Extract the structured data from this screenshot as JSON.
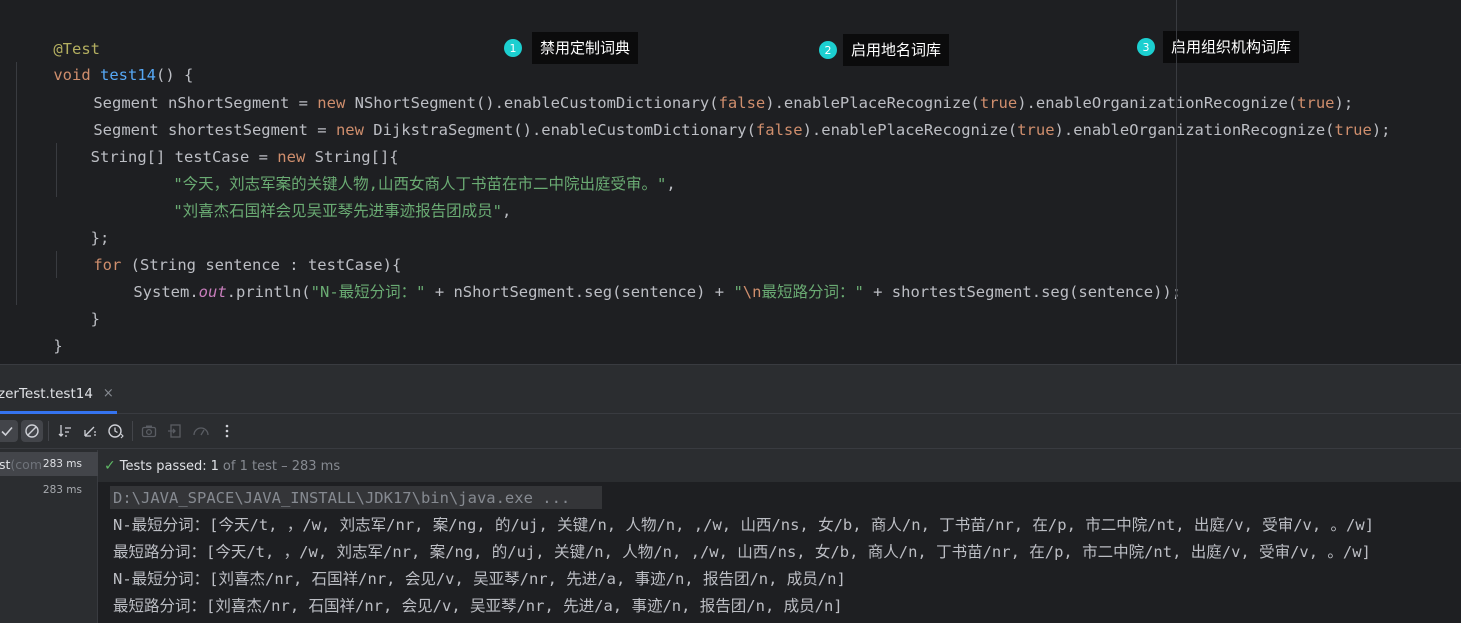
{
  "editor": {
    "annotation": "@Test",
    "method_sig": {
      "void": "void",
      "name": "test14",
      "rest": "() {"
    },
    "line3": {
      "indent": "    ",
      "type": "Segment",
      "var": " nShortSegment = ",
      "new": "new",
      "cls": " NShortSegment().enableCustomDictionary(",
      "b1": "false",
      "m2": ").enablePlaceRecognize(",
      "b2": "true",
      "m3": ").enableOrganizationRecognize(",
      "b3": "true",
      "end": ");"
    },
    "line4": {
      "indent": "    ",
      "type": "Segment",
      "var": " shortestSegment = ",
      "new": "new",
      "cls": " DijkstraSegment().enableCustomDictionary(",
      "b1": "false",
      "m2": ").enablePlaceRecognize(",
      "b2": "true",
      "m3": ").enableOrganizationRecognize(",
      "b3": "true",
      "end": ");"
    },
    "line5": {
      "pre": "    String[] testCase = ",
      "new": "new",
      "post": " String[]{"
    },
    "line6": {
      "str": "\"今天，刘志军案的关键人物,山西女商人丁书苗在市二中院出庭受审。\"",
      "end": ","
    },
    "line7": {
      "str": "\"刘喜杰石国祥会见吴亚琴先进事迹报告团成员\"",
      "end": ","
    },
    "line8": "    };",
    "line9": {
      "for": "for",
      "rest": " (String sentence : testCase){"
    },
    "line10": {
      "pre": "System.",
      "out": "out",
      "mid": ".println(",
      "s1": "\"N-最短分词：\"",
      "plus1": " + nShortSegment.seg(sentence) + ",
      "s2a": "\"",
      "esc": "\\n",
      "s2b": "最短路分词：\"",
      "plus2": " + shortestSegment.seg(sentence));"
    },
    "line11": "    }",
    "line12": "}"
  },
  "callouts": [
    {
      "num": "1",
      "label": "禁用定制词典"
    },
    {
      "num": "2",
      "label": "启用地名词库"
    },
    {
      "num": "3",
      "label": "启用组织机构词库"
    }
  ],
  "run_panel": {
    "tab_title": "zerTest.test14",
    "tab_close": "×",
    "tree": {
      "row1_name": "st",
      "row1_comment": " (com",
      "row1_time": "283 ms",
      "row2_time": "283 ms"
    },
    "status": {
      "check": "✓",
      "passed": "Tests passed:",
      "count": "1",
      "detail": "of 1 test – 283 ms"
    },
    "console": {
      "cmd": "D:\\JAVA_SPACE\\JAVA_INSTALL\\JDK17\\bin\\java.exe ...",
      "lines": [
        "N-最短分词：[今天/t, ，/w, 刘志军/nr, 案/ng, 的/uj, 关键/n, 人物/n, ,/w, 山西/ns, 女/b, 商人/n, 丁书苗/nr, 在/p, 市二中院/nt, 出庭/v, 受审/v, 。/w]",
        "最短路分词：[今天/t, ，/w, 刘志军/nr, 案/ng, 的/uj, 关键/n, 人物/n, ,/w, 山西/ns, 女/b, 商人/n, 丁书苗/nr, 在/p, 市二中院/nt, 出庭/v, 受审/v, 。/w]",
        "N-最短分词：[刘喜杰/nr, 石国祥/nr, 会见/v, 吴亚琴/nr, 先进/a, 事迹/n, 报告团/n, 成员/n]",
        "最短路分词：[刘喜杰/nr, 石国祥/nr, 会见/v, 吴亚琴/nr, 先进/a, 事迹/n, 报告团/n, 成员/n]"
      ]
    }
  }
}
